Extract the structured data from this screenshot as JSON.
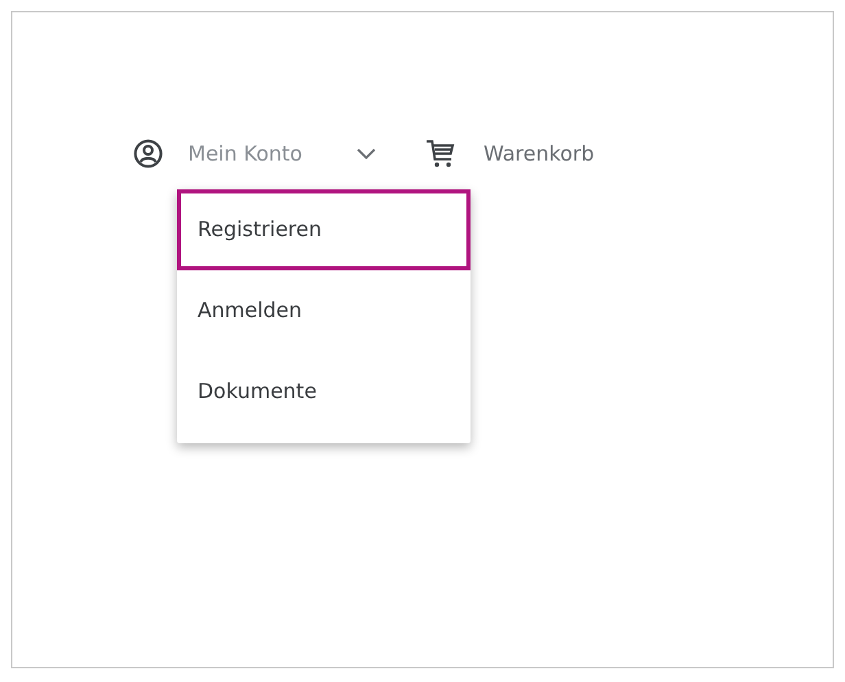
{
  "account": {
    "label": "Mein Konto"
  },
  "cart": {
    "label": "Warenkorb"
  },
  "account_menu": [
    {
      "label": "Registrieren",
      "selected": true
    },
    {
      "label": "Anmelden",
      "selected": false
    },
    {
      "label": "Dokumente",
      "selected": false
    }
  ]
}
